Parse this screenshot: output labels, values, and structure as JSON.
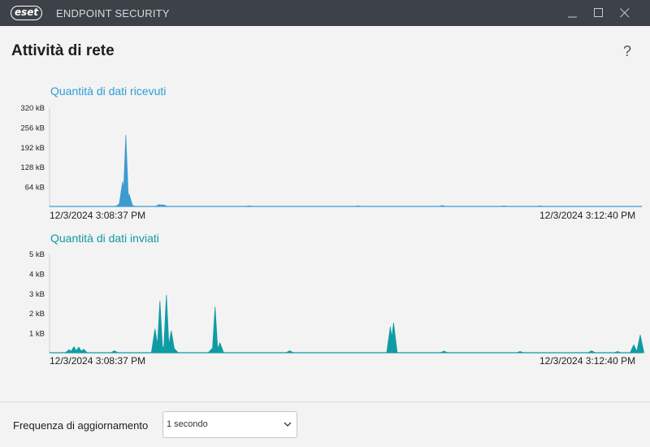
{
  "app": {
    "logo_text": "eset",
    "title": "ENDPOINT SECURITY"
  },
  "page": {
    "title": "Attività di rete",
    "help_label": "?"
  },
  "charts": {
    "received": {
      "title": "Quantità di dati ricevuti",
      "y_labels": [
        "320 kB",
        "256 kB",
        "192 kB",
        "128 kB",
        "64 kB"
      ],
      "start_time": "12/3/2024 3:08:37 PM",
      "end_time": "12/3/2024 3:12:40 PM"
    },
    "sent": {
      "title": "Quantità di dati inviati",
      "y_labels": [
        "5 kB",
        "4 kB",
        "3 kB",
        "2 kB",
        "1 kB"
      ],
      "start_time": "12/3/2024 3:08:37 PM",
      "end_time": "12/3/2024 3:12:40 PM"
    }
  },
  "chart_data": [
    {
      "type": "area",
      "title": "Quantità di dati ricevuti",
      "ylabel": "",
      "y_unit": "kB",
      "ylim": [
        0,
        320
      ],
      "yticks": [
        64,
        128,
        192,
        256,
        320
      ],
      "x_start": "12/3/2024 3:08:37 PM",
      "x_end": "12/3/2024 3:12:40 PM",
      "color": "#3d9ad3",
      "values": [
        0,
        0,
        0,
        0,
        0,
        0,
        0,
        0,
        0,
        0,
        0,
        0,
        0,
        0,
        0,
        0,
        0,
        0,
        0,
        0,
        0,
        0,
        0,
        0,
        0,
        0,
        0,
        0,
        0,
        0,
        0,
        0,
        0,
        0,
        0,
        0,
        0,
        0,
        0,
        0,
        0,
        0,
        0,
        0,
        0,
        0,
        0,
        0,
        0,
        0,
        0,
        0,
        0,
        0,
        0,
        0,
        0,
        0,
        0,
        0,
        0,
        0,
        0,
        0,
        0,
        0,
        0,
        0,
        0,
        0,
        0,
        0,
        0,
        0,
        0,
        0,
        0,
        0,
        0,
        0,
        0,
        0,
        0,
        0,
        0,
        0,
        0,
        0,
        0,
        0,
        0,
        0,
        0,
        0,
        0,
        0,
        0,
        0,
        0,
        0,
        0,
        0,
        0,
        0,
        0,
        0,
        0,
        0,
        0,
        0,
        0,
        0,
        0,
        0,
        0,
        0,
        0,
        0,
        0,
        0,
        0,
        0,
        0,
        0,
        0,
        0,
        0,
        0,
        0,
        0,
        0,
        0,
        0,
        0,
        0,
        0,
        0,
        0,
        0,
        0,
        0,
        0,
        0,
        0,
        0,
        0,
        0,
        0,
        0,
        0,
        0,
        0,
        0,
        0,
        0,
        0,
        0,
        0,
        0,
        0,
        0,
        0,
        0,
        0,
        0,
        0,
        0,
        0,
        0,
        0,
        0,
        0,
        0,
        0,
        0,
        0,
        0,
        0,
        0,
        0,
        0,
        0,
        0,
        0,
        0,
        0,
        0,
        0,
        0,
        0,
        0,
        0,
        0,
        0,
        0,
        0,
        0,
        0,
        0,
        0,
        0,
        0,
        0,
        0,
        0,
        0,
        0,
        0,
        0,
        0,
        0,
        0,
        0,
        0,
        0,
        0,
        0,
        0,
        0,
        0,
        0,
        0,
        0,
        0,
        0,
        0,
        0,
        0,
        0,
        0,
        0,
        0,
        0,
        0,
        0,
        0,
        0,
        0,
        0,
        0,
        0,
        0,
        0,
        0,
        0,
        0,
        0,
        0,
        0,
        0,
        0,
        0,
        0,
        0
      ],
      "peaks": [
        [
          86,
          8
        ],
        [
          90,
          80
        ],
        [
          94,
          230
        ],
        [
          98,
          40
        ],
        [
          101,
          5
        ],
        [
          135,
          6
        ],
        [
          138,
          6
        ],
        [
          141,
          5
        ],
        [
          246,
          2
        ],
        [
          380,
          2
        ],
        [
          484,
          3
        ],
        [
          560,
          2
        ],
        [
          605,
          2
        ]
      ]
    },
    {
      "type": "area",
      "title": "Quantità di dati inviati",
      "ylabel": "",
      "y_unit": "kB",
      "ylim": [
        0,
        5
      ],
      "yticks": [
        1,
        2,
        3,
        4,
        5
      ],
      "x_start": "12/3/2024 3:08:37 PM",
      "x_end": "12/3/2024 3:12:40 PM",
      "color": "#109ba4",
      "values": [],
      "peaks": [
        [
          24,
          0.15
        ],
        [
          30,
          0.3
        ],
        [
          36,
          0.28
        ],
        [
          42,
          0.18
        ],
        [
          80,
          0.1
        ],
        [
          130,
          1.2
        ],
        [
          136,
          2.6
        ],
        [
          140,
          0.3
        ],
        [
          144,
          2.9
        ],
        [
          150,
          1.1
        ],
        [
          154,
          0.2
        ],
        [
          200,
          0.2
        ],
        [
          204,
          2.3
        ],
        [
          210,
          0.5
        ],
        [
          296,
          0.1
        ],
        [
          420,
          1.3
        ],
        [
          424,
          1.5
        ],
        [
          486,
          0.08
        ],
        [
          580,
          0.06
        ],
        [
          668,
          0.1
        ],
        [
          700,
          0.06
        ],
        [
          720,
          0.4
        ],
        [
          728,
          0.9
        ]
      ]
    }
  ],
  "footer": {
    "label": "Frequenza di aggiornamento",
    "select_value": "1 secondo"
  }
}
